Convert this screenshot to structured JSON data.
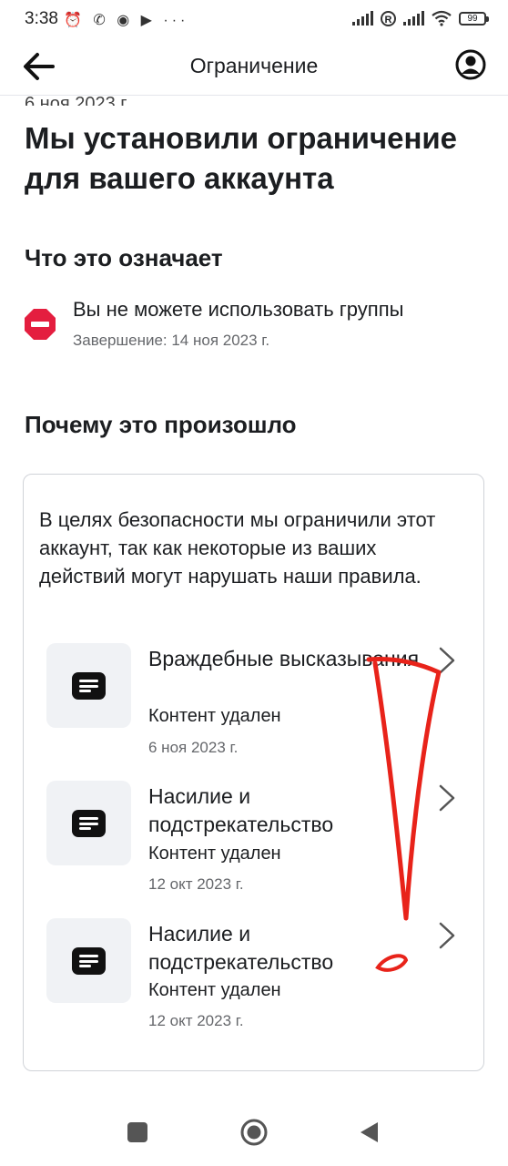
{
  "status_bar": {
    "time": "3:38",
    "left_icons": "⏰ ✆ ◉ ▶ ···",
    "roaming": "R",
    "battery": "99"
  },
  "header": {
    "title": "Ограничение"
  },
  "partial_date": "6 ноя 2023 г.",
  "page_title": "Мы установили ограничение для вашего аккаунта",
  "what_section": {
    "heading": "Что это означает",
    "restriction_text": "Вы не можете использовать группы",
    "restriction_end": "Завершение: 14 ноя 2023 г."
  },
  "why_section": {
    "heading": "Почему это произошло",
    "description": "В целях безопасности мы ограничили этот аккаунт, так как некоторые из ваших действий могут нарушать наши правила.",
    "items": [
      {
        "title": "Враждебные высказывания",
        "status": "Контент удален",
        "date": "6 ноя 2023 г."
      },
      {
        "title": "Насилие и подстрекательство",
        "status": "Контент удален",
        "date": "12 окт 2023 г."
      },
      {
        "title": "Насилие и подстрекательство",
        "status": "Контент удален",
        "date": "12 окт 2023 г."
      }
    ]
  },
  "colors": {
    "stop_red": "#e41e3f",
    "annotation_red": "#e8231a",
    "secondary_text": "#65676b"
  },
  "icons": {
    "back": "arrow-left-icon",
    "account": "user-circle-icon",
    "restriction": "stop-sign-icon",
    "item": "message-icon",
    "item_arrow": "chevron-right-icon"
  }
}
